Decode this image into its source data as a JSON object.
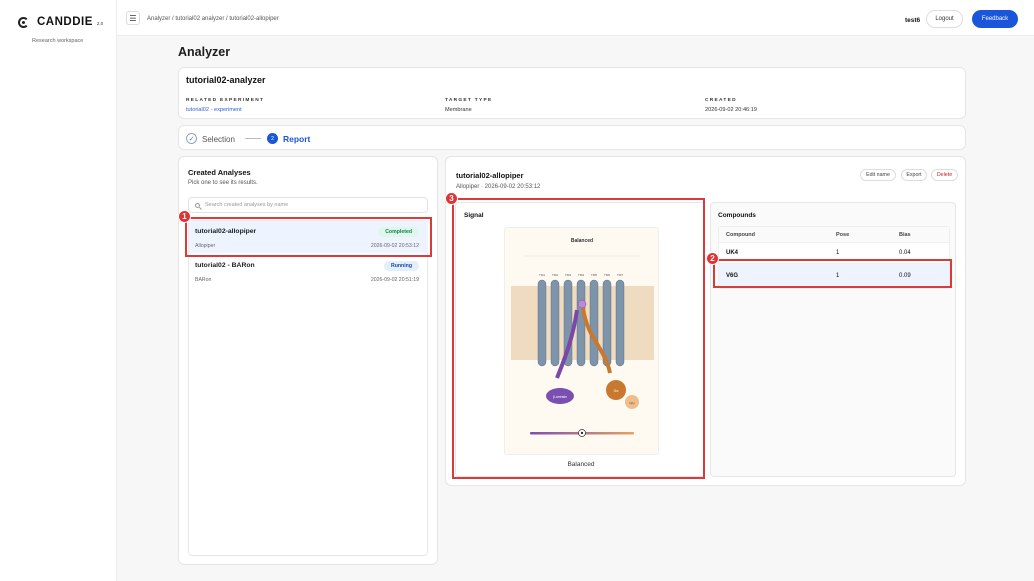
{
  "app": {
    "name": "CANDDIE",
    "version": "2.0",
    "workspace": "Research workspace"
  },
  "topbar": {
    "breadcrumb": "Analyzer / tutorial02 analyzer / tutorial02-allopiper",
    "user": "test6",
    "logout_label": "Logout",
    "feedback_label": "Feedback"
  },
  "page": {
    "title": "Analyzer"
  },
  "analyzer": {
    "name": "tutorial02-analyzer",
    "related_label": "RELATED EXPERIMENT",
    "related_value": "tutorial02 - experiment",
    "target_label": "TARGET TYPE",
    "target_value": "Membrane",
    "created_label": "CREATED",
    "created_value": "2026-09-02 20:46:19"
  },
  "steps": {
    "step1": "Selection",
    "step2_num": "2",
    "step2": "Report",
    "step1_icon": "check-icon"
  },
  "created": {
    "title": "Created Analyses",
    "subtitle": "Pick one to see its results.",
    "search_placeholder": "Search created analyses by name",
    "items": [
      {
        "name": "tutorial02-allopiper",
        "model": "Allopiper",
        "status": "Completed",
        "time": "2026-09-02 20:53:12"
      },
      {
        "name": "tutorial02 - BARon",
        "model": "BARon",
        "status": "Running",
        "time": "2026-09-02 20:51:19"
      }
    ]
  },
  "run": {
    "title": "tutorial02-allopiper",
    "subtitle": "Allopiper · 2026-09-02 20:53:12",
    "edit_label": "Edit name",
    "export_label": "Export",
    "delete_label": "Delete"
  },
  "signal": {
    "label": "Signal",
    "figure_title": "Balanced",
    "caption": "Balanced",
    "tm_labels": [
      "TM1",
      "TM2",
      "TM3",
      "TM4",
      "TM5",
      "TM6",
      "TM7"
    ],
    "beta_label": "β-arrestin",
    "g_label": "Gα",
    "gby_label": "Gβγ"
  },
  "compounds": {
    "title": "Compounds",
    "headers": [
      "Compound",
      "Pose",
      "Bias"
    ],
    "rows": [
      {
        "name": "UK4",
        "pose": "1",
        "bias": "0.04"
      },
      {
        "name": "V6G",
        "pose": "1",
        "bias": "0.09"
      }
    ]
  },
  "annotations": [
    "1",
    "2",
    "3"
  ],
  "colors": {
    "accent": "#1a56db",
    "highlight": "#d93a3a"
  }
}
